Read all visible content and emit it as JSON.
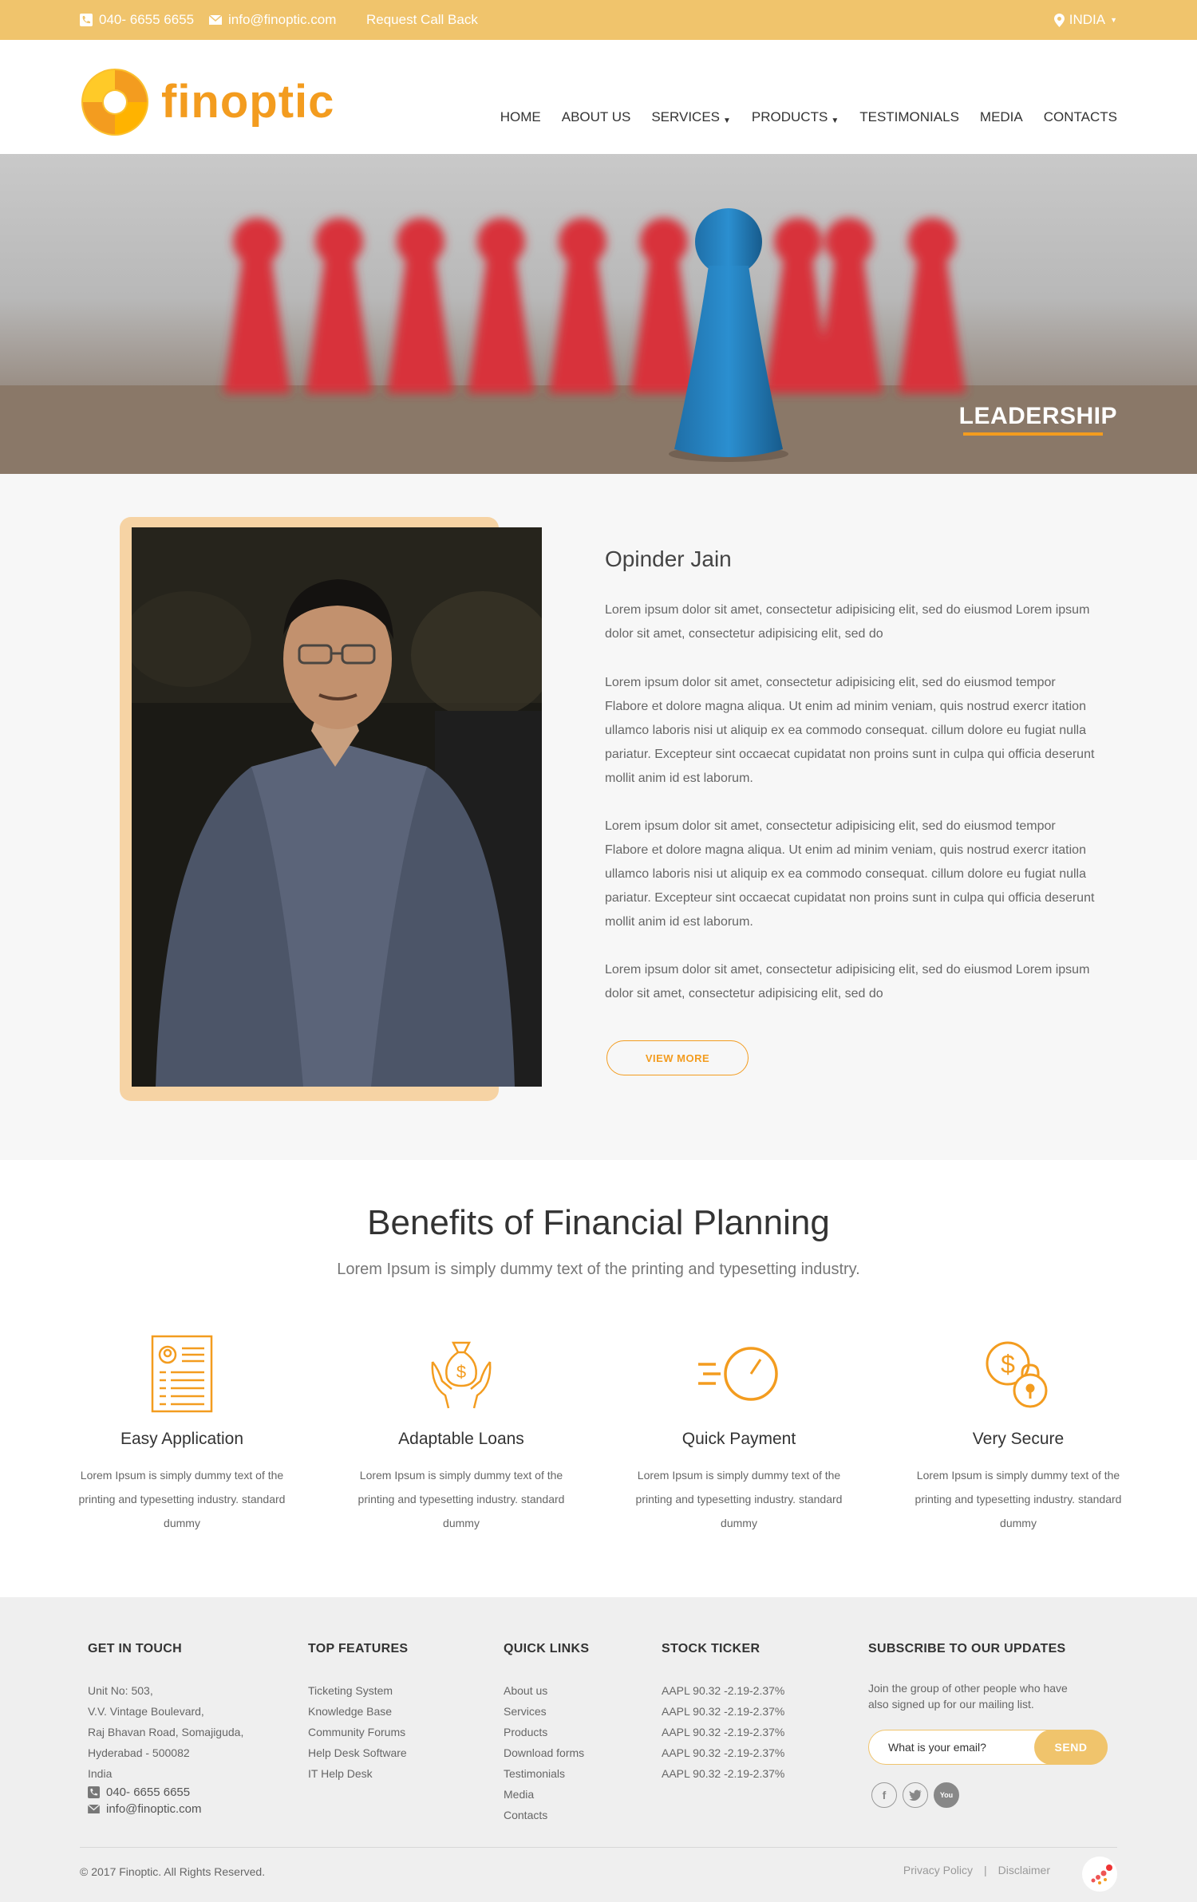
{
  "topbar": {
    "phone": "040- 6655 6655",
    "email": "info@finoptic.com",
    "callback": "Request Call Back",
    "country": "INDIA"
  },
  "header": {
    "logo_text": "finoptic",
    "nav": [
      "HOME",
      "ABOUT US",
      "SERVICES",
      "PRODUCTS",
      "TESTIMONIALS",
      "MEDIA",
      "CONTACTS"
    ]
  },
  "hero": {
    "title": "LEADERSHIP"
  },
  "leader": {
    "name": "Opinder Jain",
    "paragraphs": [
      "Lorem ipsum dolor sit amet, consectetur adipisicing elit,  sed do  eiusmod  Lorem ipsum dolor sit amet, consectetur adipisicing elit, sed do",
      "Lorem ipsum dolor sit amet, consectetur adipisicing elit, sed do eiusmod  tempor Flabore et dolore magna aliqua. Ut enim  ad  minim  veniam, quis  nostrud  exercr itation ullamco laboris nisi ut aliquip ex ea commodo consequat. cillum dolore eu fugiat nulla pariatur. Excepteur sint  occaecat  cupidatat  non  proins sunt in culpa qui officia deserunt mollit anim id est laborum.",
      "Lorem ipsum dolor sit amet, consectetur adipisicing elit, sed do eiusmod  tempor Flabore et dolore magna aliqua. Ut enim  ad  minim  veniam, quis  nostrud  exercr itation ullamco laboris nisi ut aliquip ex ea commodo consequat. cillum dolore eu fugiat nulla pariatur. Excepteur sint  occaecat  cupidatat  non  proins sunt in culpa qui officia deserunt mollit anim id est laborum.",
      "Lorem ipsum dolor sit amet, consectetur adipisicing elit,  sed do  eiusmod  Lorem ipsum dolor sit amet, consectetur adipisicing elit, sed do"
    ],
    "button": "VIEW MORE"
  },
  "benefits": {
    "title": "Benefits of Financial Planning",
    "subtitle": "Lorem Ipsum is simply dummy text of the printing and typesetting industry.",
    "items": [
      {
        "name": "Easy Application",
        "icon": "application-form-icon",
        "desc": "Lorem Ipsum is simply dummy text of the printing and typesetting industry. standard dummy"
      },
      {
        "name": "Adaptable Loans",
        "icon": "money-bag-hands-icon",
        "desc": "Lorem Ipsum is simply dummy text of the printing and typesetting industry. standard dummy"
      },
      {
        "name": "Quick Payment",
        "icon": "fast-clock-icon",
        "desc": "Lorem Ipsum is simply dummy text of the printing and typesetting industry. standard dummy"
      },
      {
        "name": "Very Secure",
        "icon": "dollar-lock-icon",
        "desc": "Lorem Ipsum is simply dummy text of the printing and typesetting industry. standard dummy"
      }
    ]
  },
  "footer": {
    "get_in_touch": {
      "heading": "GET IN TOUCH",
      "address": [
        "Unit No: 503,",
        "V.V. Vintage Boulevard,",
        "Raj Bhavan Road, Somajiguda,",
        "Hyderabad - 500082",
        "India"
      ],
      "phone": "040- 6655 6655",
      "email": "info@finoptic.com"
    },
    "top_features": {
      "heading": "TOP FEATURES",
      "items": [
        "Ticketing System",
        "Knowledge Base",
        "Community Forums",
        "Help Desk Software",
        "IT Help Desk"
      ]
    },
    "quick_links": {
      "heading": "QUICK LINKS",
      "items": [
        "About us",
        "Services",
        "Products",
        "Download forms",
        "Testimonials",
        "Media",
        "Contacts"
      ]
    },
    "stock_ticker": {
      "heading": "STOCK TICKER",
      "items": [
        "AAPL 90.32 -2.19-2.37%",
        "AAPL 90.32 -2.19-2.37%",
        "AAPL 90.32 -2.19-2.37%",
        "AAPL 90.32 -2.19-2.37%",
        "AAPL 90.32 -2.19-2.37%"
      ]
    },
    "subscribe": {
      "heading": "SUBSCRIBE TO OUR UPDATES",
      "text_line1": "Join the group of other people who have",
      "text_line2": "also signed up for our mailing list.",
      "placeholder": "What is your email?",
      "button": "SEND"
    },
    "social": {
      "youtube_label": "You"
    },
    "copyright": "© 2017 Finoptic. All Rights Reserved.",
    "links": {
      "privacy": "Privacy Policy",
      "separator": "|",
      "disclaimer": "Disclaimer"
    }
  },
  "colors": {
    "accent": "#f39c1f",
    "topbar": "#f0c46c",
    "frame": "#f6d3a4"
  }
}
